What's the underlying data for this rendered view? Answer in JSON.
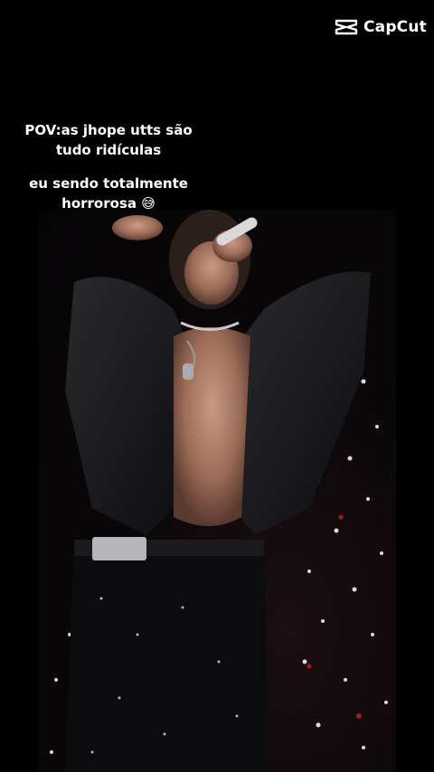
{
  "watermark": {
    "brand": "CapCut",
    "icon": "capcut-logo-icon"
  },
  "captions": {
    "line1a": "POV:as jhope utts são",
    "line1b": "tudo ridículas",
    "line2a": "eu sendo totalmente",
    "line2b": "horrorosa 😅"
  },
  "colors": {
    "background": "#000000",
    "text": "#ffffff"
  }
}
